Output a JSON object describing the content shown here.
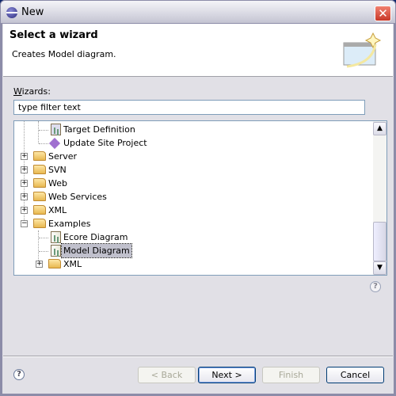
{
  "window": {
    "title": "New",
    "close_icon": "close-icon"
  },
  "header": {
    "title": "Select a wizard",
    "description": "Creates Model diagram."
  },
  "wizards": {
    "label_mnemonic": "W",
    "label_rest": "izards:",
    "filter_value": "type filter text"
  },
  "tree": {
    "items": [
      {
        "label": "Target Definition",
        "type": "item"
      },
      {
        "label": "Update Site Project",
        "type": "item"
      },
      {
        "label": "Server",
        "type": "folder",
        "expanded": false
      },
      {
        "label": "SVN",
        "type": "folder",
        "expanded": false
      },
      {
        "label": "Web",
        "type": "folder",
        "expanded": false
      },
      {
        "label": "Web Services",
        "type": "folder",
        "expanded": false
      },
      {
        "label": "XML",
        "type": "folder",
        "expanded": false
      },
      {
        "label": "Examples",
        "type": "folder",
        "expanded": true
      },
      {
        "label": "Ecore Diagram",
        "type": "item"
      },
      {
        "label": "Model Diagram",
        "type": "item",
        "selected": true
      },
      {
        "label": "XML",
        "type": "folder",
        "expanded": false
      }
    ]
  },
  "buttons": {
    "back": "< Back",
    "next": "Next >",
    "finish": "Finish",
    "cancel": "Cancel"
  },
  "help": "?"
}
